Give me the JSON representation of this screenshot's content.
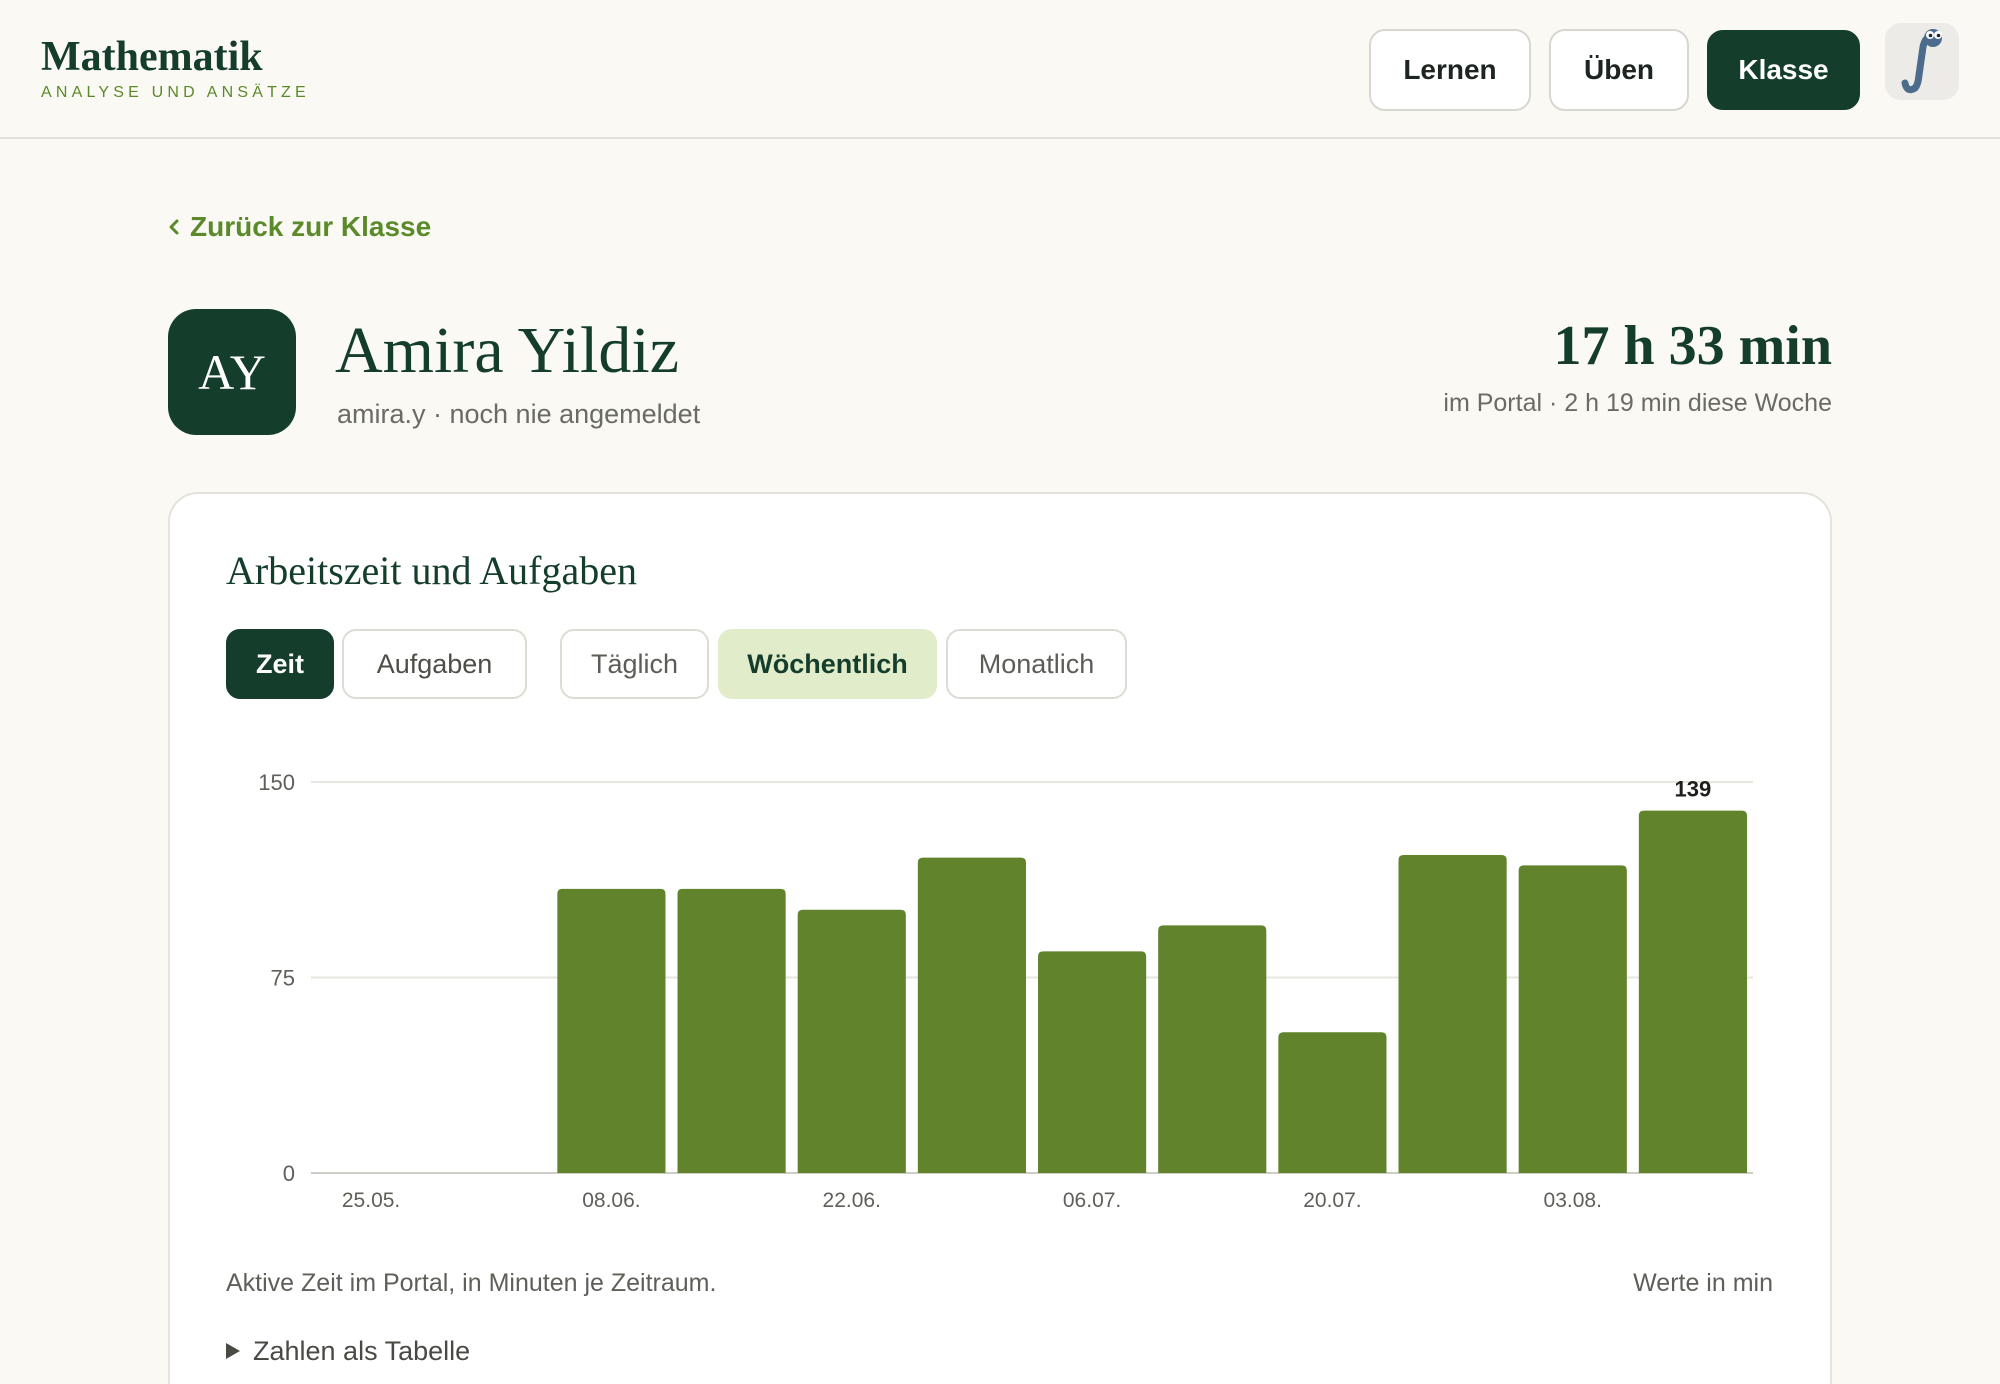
{
  "header": {
    "brand_title": "Mathematik",
    "brand_subtitle": "ANALYSE UND ANSÄTZE",
    "nav": [
      {
        "label": "Lernen",
        "active": false
      },
      {
        "label": "Üben",
        "active": false
      },
      {
        "label": "Klasse",
        "active": true
      }
    ],
    "profile_icon": "integral-mascot-icon"
  },
  "back_link": {
    "label": "Zurück zur Klasse",
    "icon": "chevron-left-icon"
  },
  "student": {
    "initials": "AY",
    "name": "Amira Yildiz",
    "meta": "amira.y · noch nie angemeldet"
  },
  "time_summary": {
    "total": "17 h 33 min",
    "detail": "im Portal · 2 h 19 min diese Woche"
  },
  "activity_card": {
    "title": "Arbeitszeit und Aufgaben",
    "metric_tabs": [
      {
        "label": "Zeit",
        "active": true
      },
      {
        "label": "Aufgaben",
        "active": false
      }
    ],
    "period_tabs": [
      {
        "label": "Täglich",
        "active": false
      },
      {
        "label": "Wöchentlich",
        "active": true
      },
      {
        "label": "Monatlich",
        "active": false
      }
    ],
    "caption": "Aktive Zeit im Portal, in Minuten je Zeitraum.",
    "unit_note": "Werte in min",
    "table_toggle": {
      "label": "Zahlen als Tabelle",
      "icon": "disclosure-triangle-icon",
      "expanded": false
    }
  },
  "colors": {
    "brand_dark": "#143d2b",
    "accent_green": "#5b8a2a",
    "bar": "#61832b",
    "tab_active_light": "#e1eccb",
    "gridline": "#e6e5de",
    "baseline": "#cfcec6"
  },
  "chart_data": {
    "type": "bar",
    "categories": [
      "25.05.",
      "",
      "08.06.",
      "",
      "22.06.",
      "",
      "06.07.",
      "",
      "20.07.",
      "",
      "03.08.",
      ""
    ],
    "values": [
      0,
      0,
      109,
      109,
      101,
      121,
      85,
      95,
      54,
      122,
      118,
      139
    ],
    "data_labels": [
      "",
      "",
      "",
      "",
      "",
      "",
      "",
      "",
      "",
      "",
      "",
      "139"
    ],
    "yticks": [
      0,
      75,
      150
    ],
    "ylim": [
      0,
      150
    ],
    "grid": true
  }
}
